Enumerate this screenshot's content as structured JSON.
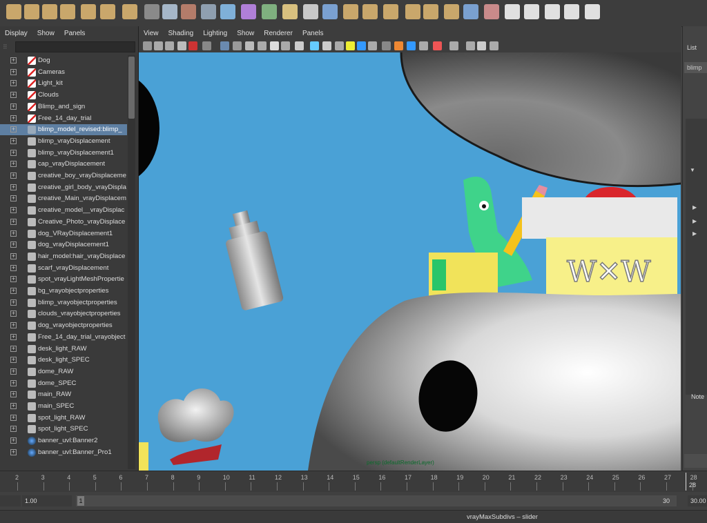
{
  "outliner": {
    "menu": [
      "Display",
      "Show",
      "Panels"
    ],
    "items": [
      {
        "label": "Dog",
        "icon": "set-icon"
      },
      {
        "label": "Cameras",
        "icon": "set-icon"
      },
      {
        "label": "Light_kit",
        "icon": "set-icon"
      },
      {
        "label": "Clouds",
        "icon": "set-icon"
      },
      {
        "label": "Blimp_and_sign",
        "icon": "set-icon"
      },
      {
        "label": "Free_14_day_trial",
        "icon": "set-icon"
      },
      {
        "label": "blimp_model_revised:blimp_",
        "icon": "mesh-icon",
        "selected": true
      },
      {
        "label": "blimp_vrayDisplacement",
        "icon": "node-icon"
      },
      {
        "label": "blimp_vrayDisplacement1",
        "icon": "node-icon"
      },
      {
        "label": "cap_vrayDisplacement",
        "icon": "node-icon"
      },
      {
        "label": "creative_boy_vrayDisplaceme",
        "icon": "node-icon"
      },
      {
        "label": "creative_girl_body_vrayDispla",
        "icon": "node-icon"
      },
      {
        "label": "creative_Main_vrayDisplacem",
        "icon": "node-icon"
      },
      {
        "label": "creative_model__vrayDisplac",
        "icon": "node-icon"
      },
      {
        "label": "Creative_Photo_vrayDisplace",
        "icon": "node-icon"
      },
      {
        "label": "dog_VRayDisplacement1",
        "icon": "node-icon"
      },
      {
        "label": "dog_vrayDisplacement1",
        "icon": "node-icon"
      },
      {
        "label": "hair_model:hair_vrayDisplace",
        "icon": "node-icon"
      },
      {
        "label": "scarf_vrayDisplacement",
        "icon": "node-icon"
      },
      {
        "label": "spot_vrayLightMeshPropertie",
        "icon": "node-icon"
      },
      {
        "label": "bg_vrayobjectproperties",
        "icon": "node-icon"
      },
      {
        "label": "blimp_vrayobjectproperties",
        "icon": "node-icon"
      },
      {
        "label": "clouds_vrayobjectproperties",
        "icon": "node-icon"
      },
      {
        "label": "dog_vrayobjectproperties",
        "icon": "node-icon"
      },
      {
        "label": "Free_14_day_trial_vrayobject",
        "icon": "node-icon"
      },
      {
        "label": "desk_light_RAW",
        "icon": "node-icon"
      },
      {
        "label": "desk_light_SPEC",
        "icon": "node-icon"
      },
      {
        "label": "dome_RAW",
        "icon": "node-icon"
      },
      {
        "label": "dome_SPEC",
        "icon": "node-icon"
      },
      {
        "label": "main_RAW",
        "icon": "node-icon"
      },
      {
        "label": "main_SPEC",
        "icon": "node-icon"
      },
      {
        "label": "spot_light_RAW",
        "icon": "node-icon"
      },
      {
        "label": "spot_light_SPEC",
        "icon": "node-icon"
      },
      {
        "label": "banner_uvl:Banner2",
        "icon": "globe-icon"
      },
      {
        "label": "banner_uvl:Banner_Pro1",
        "icon": "globe-icon"
      }
    ]
  },
  "viewport": {
    "menu": [
      "View",
      "Shading",
      "Lighting",
      "Show",
      "Renderer",
      "Panels"
    ],
    "camera_label": "persp (defaultRenderLayer)",
    "sign_text": "W✕W"
  },
  "right_panel": {
    "list_label": "List",
    "field_text": "blimp",
    "notes_label": "Note"
  },
  "timeline": {
    "ticks": [
      "2",
      "3",
      "4",
      "5",
      "6",
      "7",
      "8",
      "9",
      "10",
      "11",
      "12",
      "13",
      "14",
      "15",
      "16",
      "17",
      "18",
      "19",
      "20",
      "21",
      "22",
      "23",
      "24",
      "25",
      "26",
      "27",
      "28"
    ],
    "current_frame": "28",
    "current_frame_sub": "28"
  },
  "range": {
    "start_value": "1.00",
    "slider_start": "1",
    "slider_end": "30",
    "end_value": "30.00"
  },
  "status": {
    "help_text": "vrayMaxSubdivs – slider"
  }
}
